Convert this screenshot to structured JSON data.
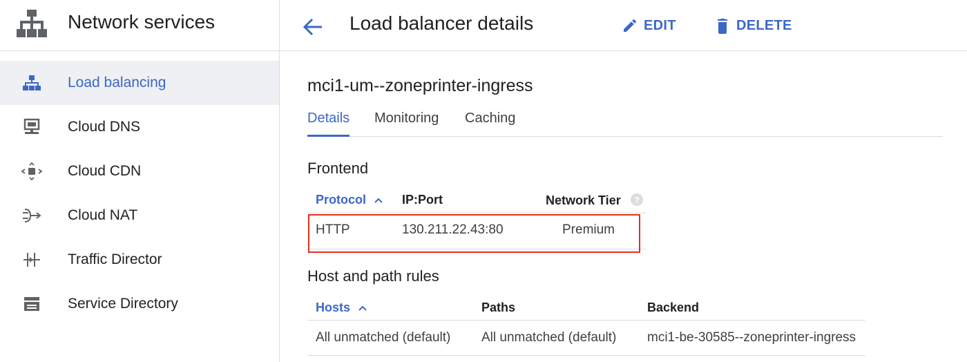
{
  "sidebar": {
    "product_title": "Network services",
    "items": [
      {
        "label": "Load balancing",
        "icon": "load-balancing-icon",
        "active": true
      },
      {
        "label": "Cloud DNS",
        "icon": "cloud-dns-icon",
        "active": false
      },
      {
        "label": "Cloud CDN",
        "icon": "cloud-cdn-icon",
        "active": false
      },
      {
        "label": "Cloud NAT",
        "icon": "cloud-nat-icon",
        "active": false
      },
      {
        "label": "Traffic Director",
        "icon": "traffic-director-icon",
        "active": false
      },
      {
        "label": "Service Directory",
        "icon": "service-directory-icon",
        "active": false
      }
    ]
  },
  "header": {
    "title": "Load balancer details",
    "edit_label": "EDIT",
    "delete_label": "DELETE"
  },
  "main": {
    "lb_name": "mci1-um--zoneprinter-ingress",
    "tabs": [
      {
        "label": "Details",
        "active": true
      },
      {
        "label": "Monitoring",
        "active": false
      },
      {
        "label": "Caching",
        "active": false
      }
    ],
    "frontend": {
      "title": "Frontend",
      "columns": [
        "Protocol",
        "IP:Port",
        "Network Tier"
      ],
      "rows": [
        {
          "protocol": "HTTP",
          "ip_port": "130.211.22.43:80",
          "tier": "Premium"
        }
      ]
    },
    "host_rules": {
      "title": "Host and path rules",
      "columns": [
        "Hosts",
        "Paths",
        "Backend"
      ],
      "rows": [
        {
          "hosts": "All unmatched (default)",
          "paths": "All unmatched (default)",
          "backend": "mci1-be-30585--zoneprinter-ingress"
        }
      ]
    }
  },
  "colors": {
    "accent": "#3b67c8",
    "highlight": "#e0301e",
    "active_nav_bg": "#eef0f4"
  }
}
